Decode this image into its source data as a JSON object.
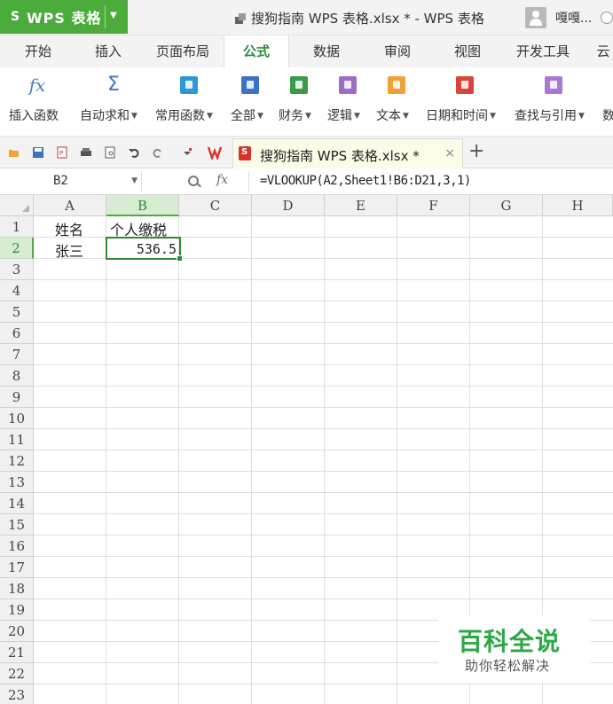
{
  "app": {
    "name": "WPS 表格",
    "window_title": "搜狗指南  WPS  表格.xlsx * - WPS 表格",
    "user_name": "嘎嘎..."
  },
  "menu": {
    "tabs": [
      "开始",
      "插入",
      "页面布局",
      "公式",
      "数据",
      "审阅",
      "视图",
      "开发工具",
      "云"
    ],
    "active": "公式"
  },
  "ribbon": {
    "items": [
      {
        "label": "插入函数",
        "icon": "fx-icon",
        "dropdown": false
      },
      {
        "label": "自动求和",
        "icon": "sigma-icon",
        "dropdown": true
      },
      {
        "label": "常用函数",
        "icon": "star-book-icon",
        "dropdown": true
      },
      {
        "label": "全部",
        "icon": "list-book-icon",
        "dropdown": true
      },
      {
        "label": "财务",
        "icon": "finance-book-icon",
        "dropdown": true
      },
      {
        "label": "逻辑",
        "icon": "logic-book-icon",
        "dropdown": true
      },
      {
        "label": "文本",
        "icon": "text-book-icon",
        "dropdown": true
      },
      {
        "label": "日期和时间",
        "icon": "clock-book-icon",
        "dropdown": true
      },
      {
        "label": "查找与引用",
        "icon": "search-book-icon",
        "dropdown": true
      },
      {
        "label": "数",
        "icon": "",
        "dropdown": false
      }
    ],
    "colors": {
      "star": "#2f97d6",
      "list": "#3b73c4",
      "finance": "#3a9a48",
      "logic": "#9d6cc8",
      "text": "#f0a034",
      "clock": "#d9443b",
      "search": "#a879d2"
    }
  },
  "document_tab": {
    "label": "搜狗指南  WPS  表格.xlsx *",
    "close": "×",
    "add": "+"
  },
  "formula_bar": {
    "name_box": "B2",
    "fx_label": "fx",
    "formula": "=VLOOKUP(A2,Sheet1!B6:D21,3,1)"
  },
  "sheet": {
    "columns": [
      "A",
      "B",
      "C",
      "D",
      "E",
      "F",
      "G",
      "H"
    ],
    "rows": [
      "1",
      "2",
      "3",
      "4",
      "5",
      "6",
      "7",
      "8",
      "9",
      "10",
      "11",
      "12",
      "13",
      "14",
      "15",
      "16",
      "17",
      "18",
      "19",
      "20",
      "21",
      "22",
      "23"
    ],
    "selected_column": "B",
    "selected_row": "2",
    "cells": {
      "A1": "姓名",
      "B1": "个人缴税",
      "A2": "张三",
      "B2": "536.5"
    }
  },
  "watermark": {
    "title": "百科全说",
    "subtitle": "助你轻松解决"
  },
  "theme": {
    "accent": "#4bab3b",
    "selection": "#2e8b2e"
  }
}
